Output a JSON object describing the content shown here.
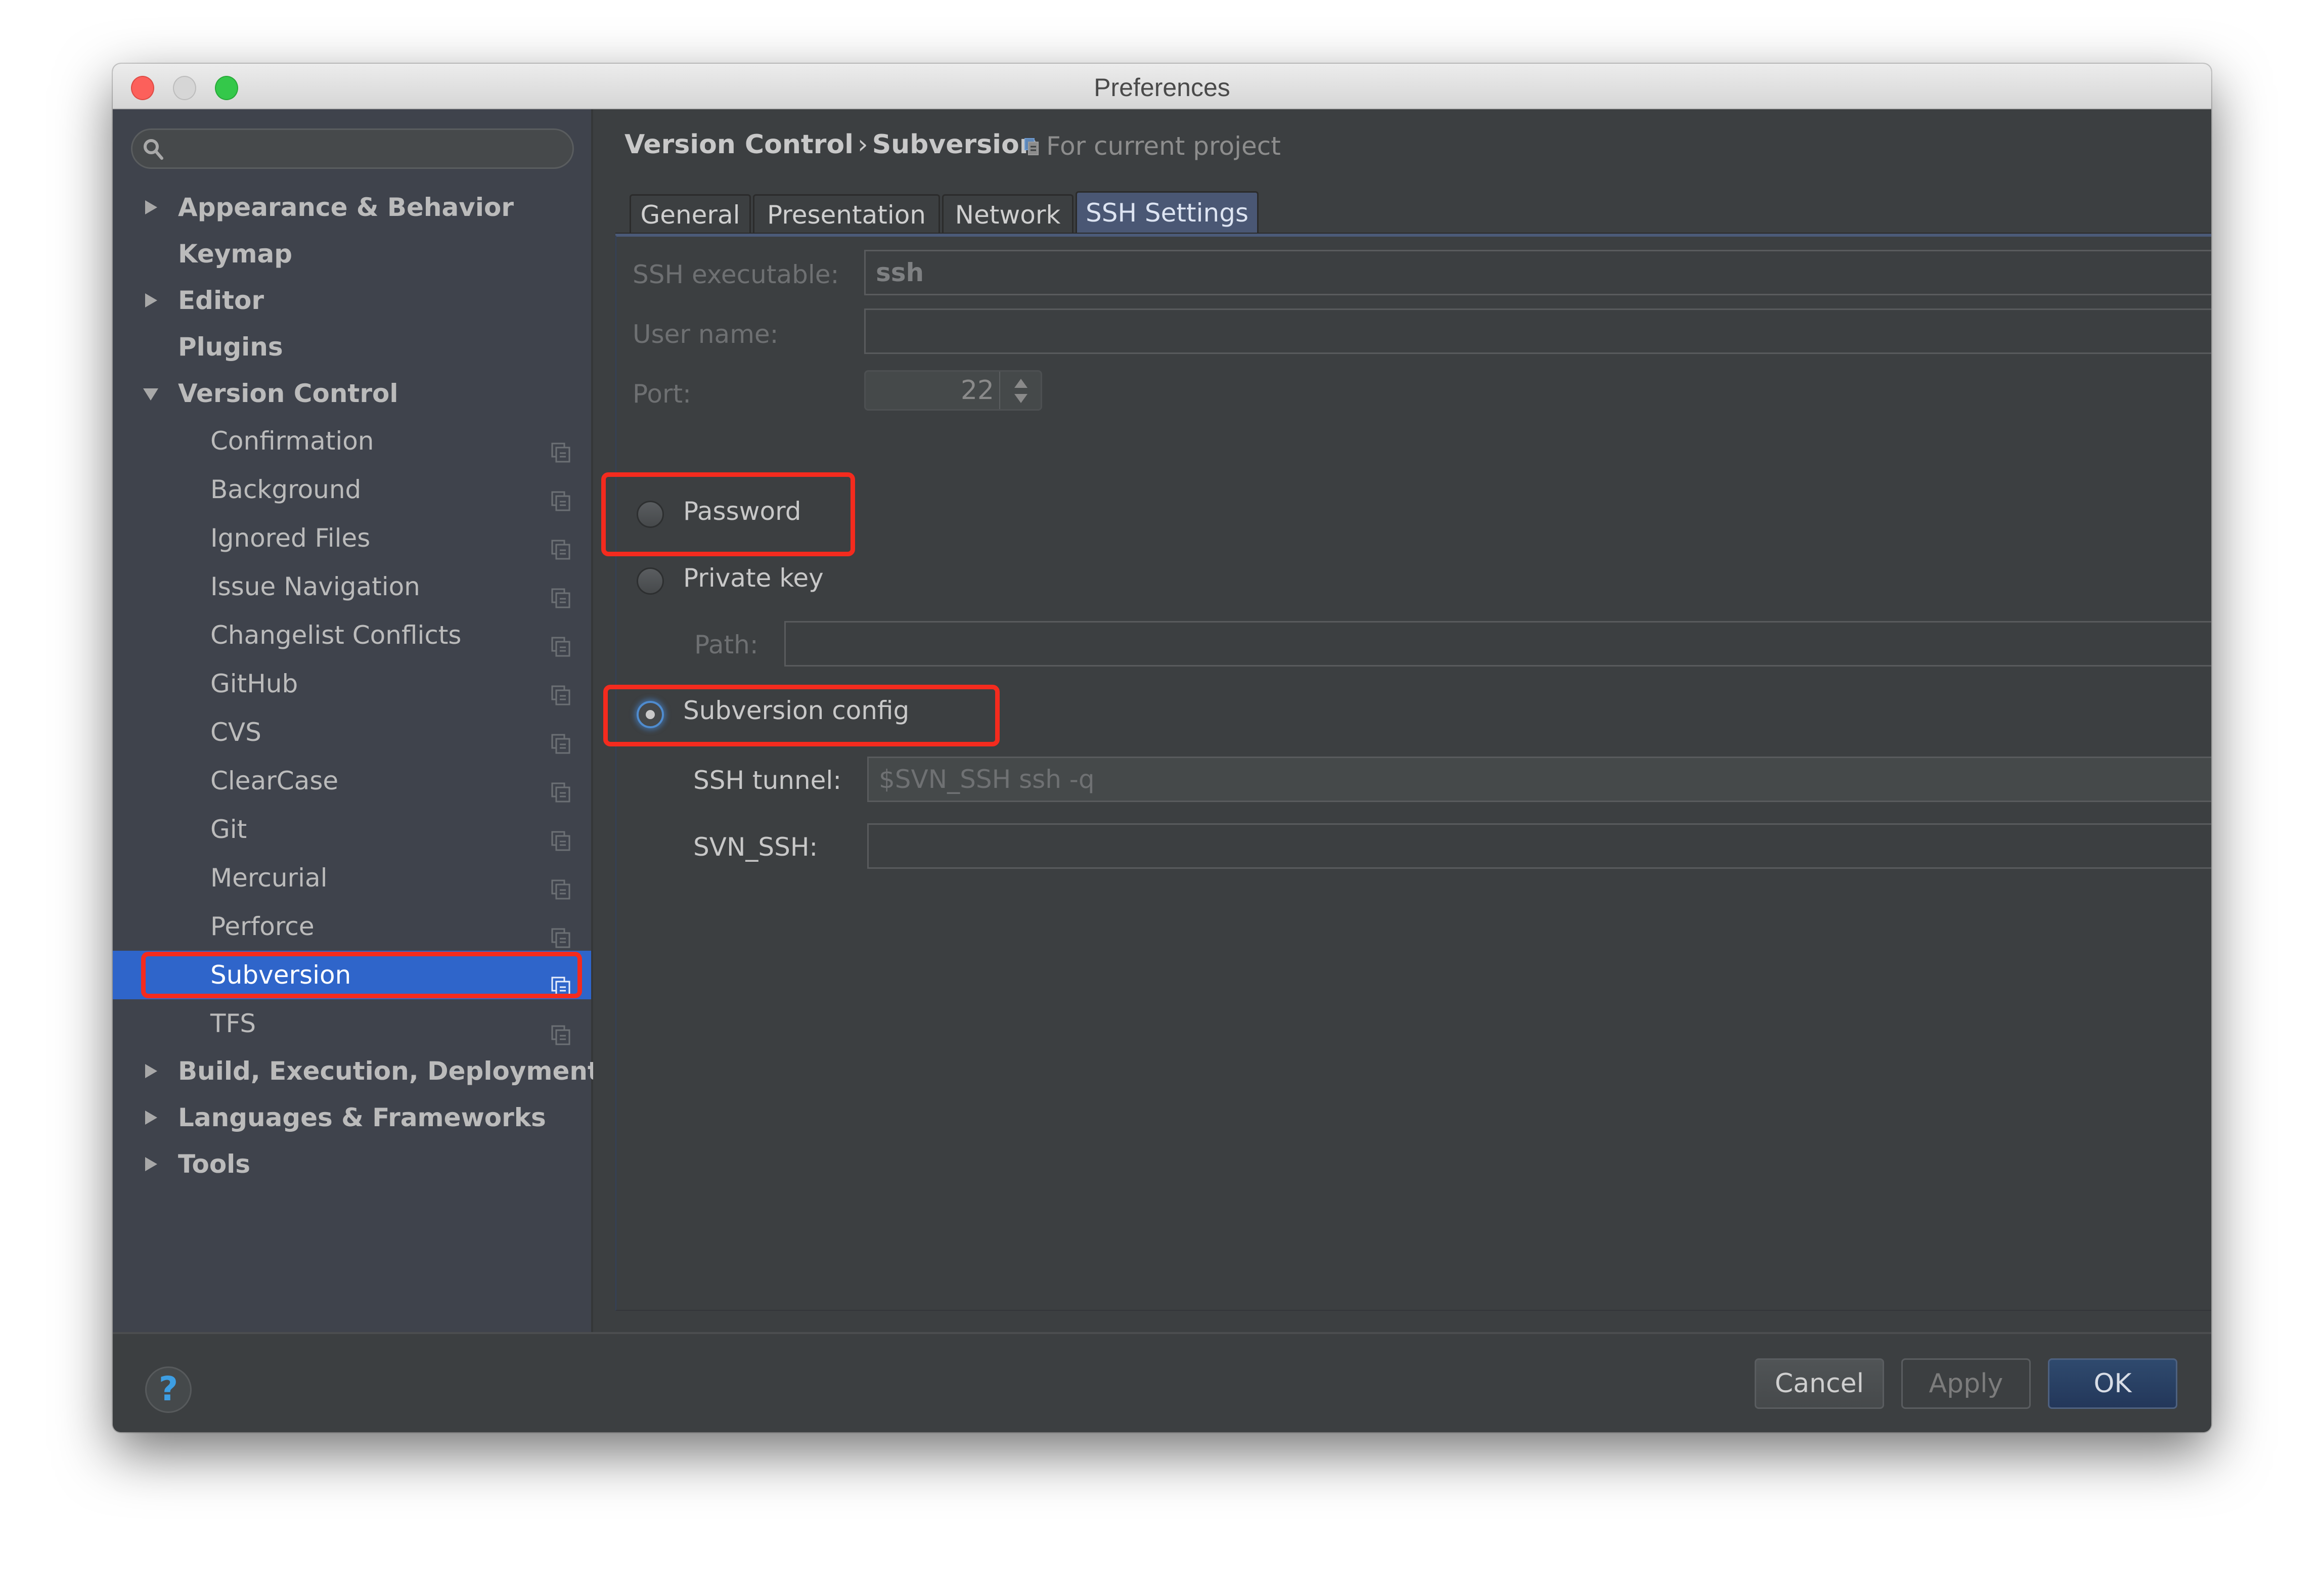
{
  "window": {
    "title": "Preferences",
    "controls": [
      "close",
      "minimize",
      "zoom"
    ]
  },
  "sidebar": {
    "search": {
      "placeholder": "",
      "value": "",
      "icon": "search-icon"
    },
    "items": [
      {
        "label": "Appearance & Behavior",
        "level": 0,
        "expandable": true,
        "expanded": false
      },
      {
        "label": "Keymap",
        "level": 0,
        "expandable": false
      },
      {
        "label": "Editor",
        "level": 0,
        "expandable": true,
        "expanded": false
      },
      {
        "label": "Plugins",
        "level": 0,
        "expandable": false
      },
      {
        "label": "Version Control",
        "level": 0,
        "expandable": true,
        "expanded": true
      },
      {
        "label": "Confirmation",
        "level": 1,
        "project_icon": true
      },
      {
        "label": "Background",
        "level": 1,
        "project_icon": true
      },
      {
        "label": "Ignored Files",
        "level": 1,
        "project_icon": true
      },
      {
        "label": "Issue Navigation",
        "level": 1,
        "project_icon": true
      },
      {
        "label": "Changelist Conflicts",
        "level": 1,
        "project_icon": true
      },
      {
        "label": "GitHub",
        "level": 1,
        "project_icon": true
      },
      {
        "label": "CVS",
        "level": 1,
        "project_icon": true
      },
      {
        "label": "ClearCase",
        "level": 1,
        "project_icon": true
      },
      {
        "label": "Git",
        "level": 1,
        "project_icon": true
      },
      {
        "label": "Mercurial",
        "level": 1,
        "project_icon": true
      },
      {
        "label": "Perforce",
        "level": 1,
        "project_icon": true
      },
      {
        "label": "Subversion",
        "level": 1,
        "project_icon": true,
        "selected": true
      },
      {
        "label": "TFS",
        "level": 1,
        "project_icon": true
      },
      {
        "label": "Build, Execution, Deployment",
        "level": 0,
        "expandable": true,
        "expanded": false
      },
      {
        "label": "Languages & Frameworks",
        "level": 0,
        "expandable": true,
        "expanded": false
      },
      {
        "label": "Tools",
        "level": 0,
        "expandable": true,
        "expanded": false
      }
    ]
  },
  "header": {
    "breadcrumb": [
      "Version Control",
      "Subversion"
    ],
    "separator": "›",
    "scope_label": "For current project"
  },
  "tabs": [
    {
      "label": "General",
      "active": false
    },
    {
      "label": "Presentation",
      "active": false
    },
    {
      "label": "Network",
      "active": false
    },
    {
      "label": "SSH Settings",
      "active": true
    }
  ],
  "ssh_settings": {
    "ssh_executable": {
      "label": "SSH executable:",
      "value": "ssh",
      "enabled": false
    },
    "user_name": {
      "label": "User name:",
      "value": "",
      "enabled": false
    },
    "port": {
      "label": "Port:",
      "value": "22",
      "enabled": false
    },
    "auth_options": [
      {
        "label": "Password",
        "checked": false,
        "highlighted": true
      },
      {
        "label": "Private key",
        "checked": false,
        "highlighted": false
      },
      {
        "label": "Subversion config",
        "checked": true,
        "highlighted": true
      }
    ],
    "path": {
      "label": "Path:",
      "value": "",
      "enabled": false
    },
    "ssh_tunnel": {
      "label": "SSH tunnel:",
      "value": "$SVN_SSH ssh -q"
    },
    "svn_ssh": {
      "label": "SVN_SSH:",
      "value": ""
    }
  },
  "footer": {
    "help_label": "?",
    "buttons": {
      "cancel": "Cancel",
      "apply": "Apply",
      "ok": "OK"
    }
  },
  "colors": {
    "selection": "#2f65ca",
    "highlight_box": "#f42b1e",
    "active_tab": "#4a5774",
    "help_icon": "#3d9ee3"
  }
}
